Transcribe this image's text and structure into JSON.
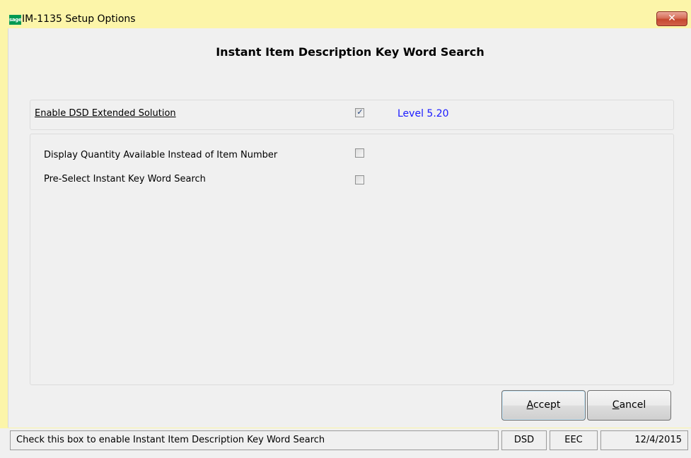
{
  "window": {
    "title": "IM-1135 Setup Options",
    "logo_text": "sage",
    "close_glyph": "✕"
  },
  "header": {
    "heading": "Instant Item Description Key Word Search"
  },
  "options": {
    "enable": {
      "label": "Enable DSD Extended Solution",
      "checked": true,
      "level": "Level  5.20"
    },
    "display_qty": {
      "label": "Display Quantity Available Instead of Item Number",
      "checked": false
    },
    "preselect": {
      "label": "Pre-Select Instant Key Word Search",
      "checked": false
    },
    "checkmark_glyph": "✓"
  },
  "buttons": {
    "accept": {
      "mnemonic": "A",
      "rest": "ccept"
    },
    "cancel": {
      "mnemonic": "C",
      "rest": "ancel"
    }
  },
  "statusbar": {
    "message": "Check this box to enable Instant Item Description Key Word Search",
    "module": "DSD",
    "company": "EEC",
    "date": "12/4/2015"
  },
  "colors": {
    "window_frame": "#fcf5a9",
    "level_text": "#1a1aff",
    "logo_green": "#009a53"
  },
  "icons": {
    "app_logo": "sage-logo-icon",
    "close": "close-icon",
    "checkmark": "checkmark-icon"
  }
}
